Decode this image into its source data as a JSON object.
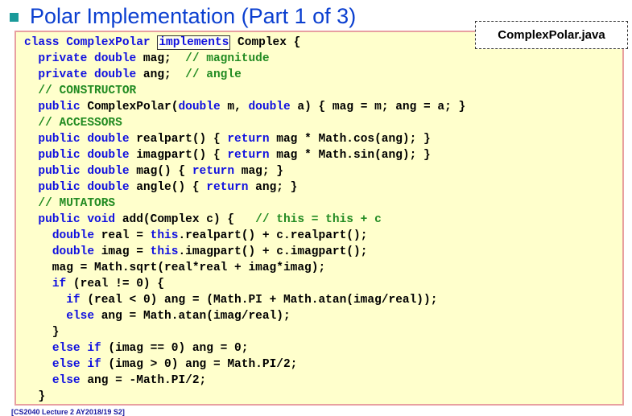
{
  "slide": {
    "title": "Polar Implementation (Part 1 of 3)",
    "file_label": "ComplexPolar.java",
    "footer": "[CS2040 Lecture 2 AY2018/19 S2]"
  },
  "code": {
    "l01": [
      "class ComplexPolar ",
      "implements",
      " Complex {"
    ],
    "l02": [
      "  ",
      "private double",
      " mag;  ",
      "// magnitude"
    ],
    "l03": [
      "  ",
      "private double",
      " ang;  ",
      "// angle"
    ],
    "l04": [
      "  ",
      "// CONSTRUCTOR"
    ],
    "l05": [
      "  ",
      "public",
      " ComplexPolar(",
      "double",
      " m, ",
      "double",
      " a) { mag = m; ang = a; }"
    ],
    "l06": [
      "  ",
      "// ACCESSORS"
    ],
    "l07": [
      "  ",
      "public double",
      " realpart() { ",
      "return",
      " mag * Math.cos(ang); }"
    ],
    "l08": [
      "  ",
      "public double",
      " imagpart() { ",
      "return",
      " mag * Math.sin(ang); }"
    ],
    "l09": [
      "  ",
      "public double",
      " mag() { ",
      "return",
      " mag; }"
    ],
    "l10": [
      "  ",
      "public double",
      " angle() { ",
      "return",
      " ang; }"
    ],
    "l11": [
      "  ",
      "// MUTATORS"
    ],
    "l12": [
      "  ",
      "public void",
      " add(Complex c) {   ",
      "// this = this + c"
    ],
    "l13": [
      "    ",
      "double",
      " real = ",
      "this",
      ".realpart() + c.realpart();"
    ],
    "l14": [
      "    ",
      "double",
      " imag = ",
      "this",
      ".imagpart() + c.imagpart();"
    ],
    "l15": [
      "    mag = Math.sqrt(real*real + imag*imag);"
    ],
    "l16": [
      "    ",
      "if",
      " (real != 0) {"
    ],
    "l17": [
      "      ",
      "if",
      " (real < 0) ang = (Math.PI + Math.atan(imag/real));"
    ],
    "l18": [
      "      ",
      "else",
      " ang = Math.atan(imag/real);"
    ],
    "l19": [
      "    }"
    ],
    "l20": [
      "    ",
      "else if",
      " (imag == 0) ang = 0;"
    ],
    "l21": [
      "    ",
      "else if",
      " (imag > 0) ang = Math.PI/2;"
    ],
    "l22": [
      "    ",
      "else",
      " ang = -Math.PI/2;"
    ],
    "l23": [
      "  }"
    ]
  },
  "colors": {
    "title": "#0b3fd0",
    "keyword": "#1010e0",
    "comment": "#228b22",
    "code_bg": "#ffffcc"
  }
}
